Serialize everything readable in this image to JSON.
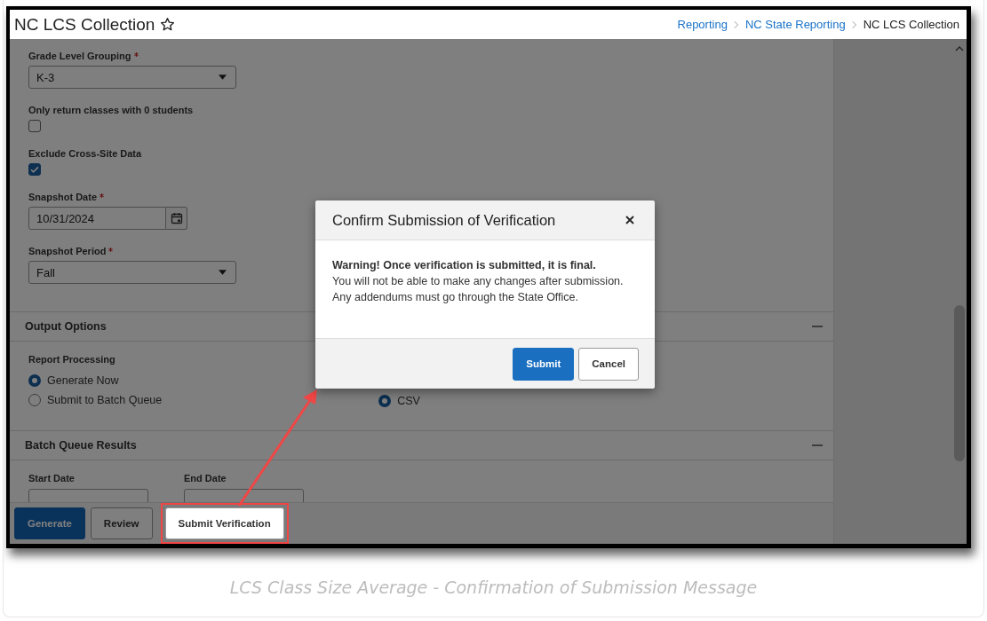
{
  "header": {
    "title": "NC LCS Collection",
    "favorite": false,
    "breadcrumbs": [
      {
        "label": "Reporting",
        "link": true
      },
      {
        "label": "NC State Reporting",
        "link": true
      },
      {
        "label": "NC LCS Collection",
        "link": false
      }
    ]
  },
  "filters": [
    {
      "kind": "select",
      "label": "Grade Level Grouping",
      "required": true,
      "value": "K-3"
    },
    {
      "kind": "checkbox",
      "label": "Only return classes with 0 students",
      "checked": false
    },
    {
      "kind": "checkbox",
      "label": "Exclude Cross-Site Data",
      "checked": true
    },
    {
      "kind": "date",
      "label": "Snapshot Date",
      "required": true,
      "value": "10/31/2024"
    },
    {
      "kind": "select",
      "label": "Snapshot Period",
      "required": true,
      "value": "Fall"
    }
  ],
  "output_options": {
    "title": "Output Options",
    "expanded": true,
    "group_label": "Report Processing",
    "processing": [
      {
        "label": "Generate Now",
        "selected": true
      },
      {
        "label": "Submit to Batch Queue",
        "selected": false
      }
    ],
    "format": [
      {
        "label": "CSV",
        "selected": true
      }
    ]
  },
  "batch_queue": {
    "title": "Batch Queue Results",
    "expanded": true,
    "fields": [
      {
        "label": "Start Date"
      },
      {
        "label": "End Date"
      }
    ]
  },
  "actions": [
    {
      "label": "Generate",
      "kind": "primary",
      "highlighted": false
    },
    {
      "label": "Review",
      "kind": "secondary",
      "highlighted": false
    },
    {
      "label": "Submit Verification",
      "kind": "secondary",
      "highlighted": true
    }
  ],
  "modal": {
    "title": "Confirm Submission of Verification",
    "warning": "Warning! Once verification is submitted, it is final.",
    "lines": [
      "You will not be able to make any changes after submission.",
      "Any addendums must go through the State Office."
    ],
    "buttons": [
      {
        "label": "Submit",
        "kind": "primary"
      },
      {
        "label": "Cancel",
        "kind": "secondary"
      }
    ]
  },
  "caption": "LCS Class Size Average - Confirmation of Submission Message"
}
